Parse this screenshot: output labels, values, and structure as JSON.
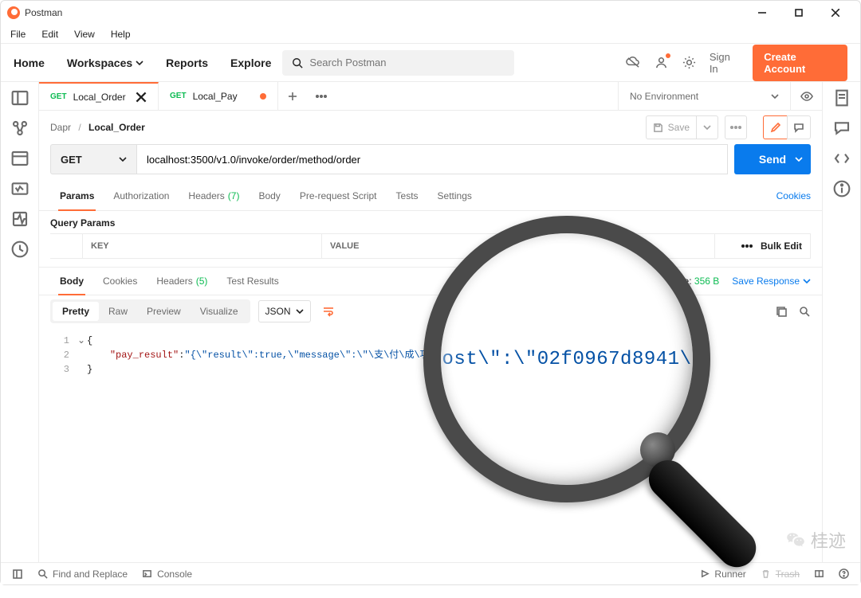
{
  "window": {
    "title": "Postman"
  },
  "menus": {
    "file": "File",
    "edit": "Edit",
    "view": "View",
    "help": "Help"
  },
  "nav": {
    "home": "Home",
    "workspaces": "Workspaces",
    "reports": "Reports",
    "explore": "Explore"
  },
  "search": {
    "placeholder": "Search Postman"
  },
  "auth": {
    "signin": "Sign In",
    "create": "Create Account"
  },
  "tabs": {
    "t0": {
      "method": "GET",
      "name": "Local_Order"
    },
    "t1": {
      "method": "GET",
      "name": "Local_Pay"
    }
  },
  "environment": {
    "selected": "No Environment"
  },
  "crumb": {
    "parent": "Dapr",
    "name": "Local_Order",
    "save": "Save"
  },
  "request": {
    "method": "GET",
    "url": "localhost:3500/v1.0/invoke/order/method/order",
    "send": "Send"
  },
  "req_tabs": {
    "params": "Params",
    "authorization": "Authorization",
    "headers": "Headers",
    "headers_count": "(7)",
    "body": "Body",
    "prerequest": "Pre-request Script",
    "tests": "Tests",
    "settings": "Settings",
    "cookies": "Cookies"
  },
  "query_params": {
    "title": "Query Params",
    "col_key": "KEY",
    "col_value": "VALUE",
    "bulk_edit": "Bulk Edit"
  },
  "res_tabs": {
    "body": "Body",
    "cookies": "Cookies",
    "headers": "Headers",
    "headers_count": "(5)",
    "test_results": "Test Results"
  },
  "res_meta": {
    "size_label": "Size:",
    "size_value": "356 B",
    "save_response": "Save Response"
  },
  "body_views": {
    "pretty": "Pretty",
    "raw": "Raw",
    "preview": "Preview",
    "visualize": "Visualize",
    "format": "JSON"
  },
  "response_body": {
    "line1": "{",
    "line2_key": "\"pay_result\"",
    "line2_sep": ":",
    "line2_val": "\"{\\\"result\\\":true,\\\"message\\\":\\\"\\支\\付\\成\\功\\\",\\\"host\\\":\\\"02f0967d8941\\\"}\"",
    "line3": "}",
    "magnified": "\"host\\\":\\\"02f0967d8941\\\"}"
  },
  "statusbar": {
    "find": "Find and Replace",
    "console": "Console",
    "runner": "Runner",
    "trash": "Trash"
  },
  "watermark": "桂迹"
}
